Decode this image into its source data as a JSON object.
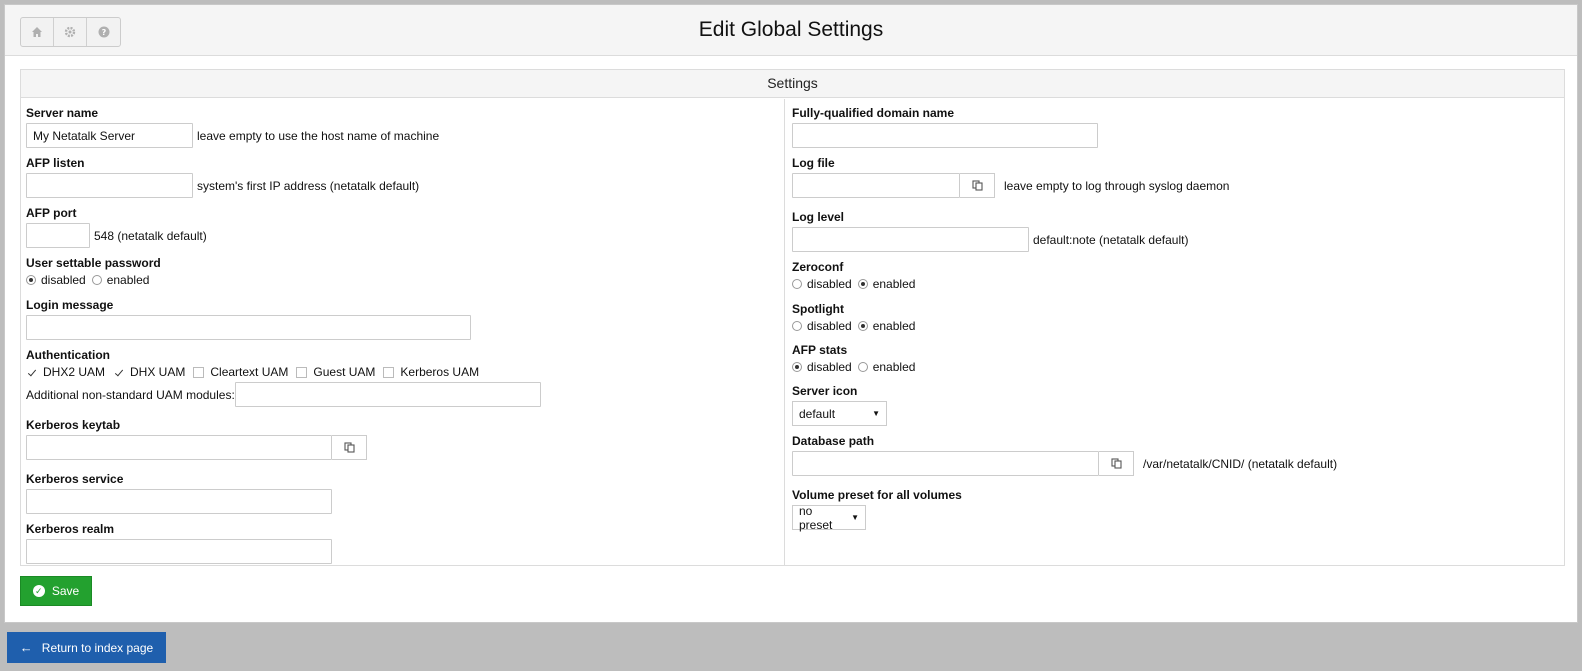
{
  "header": {
    "title": "Edit Global Settings",
    "buttons": [
      {
        "icon": "home-icon"
      },
      {
        "icon": "gear-icon"
      },
      {
        "icon": "help-icon"
      }
    ]
  },
  "settings": {
    "heading": "Settings",
    "left": {
      "server_name": {
        "label": "Server name",
        "value": "My Netatalk Server",
        "hint": "leave empty to use the host name of machine"
      },
      "afp_listen": {
        "label": "AFP listen",
        "value": "",
        "hint": "system's first IP address (netatalk default)"
      },
      "afp_port": {
        "label": "AFP port",
        "value": "",
        "hint": "548 (netatalk default)"
      },
      "user_password": {
        "label": "User settable password",
        "options": [
          "disabled",
          "enabled"
        ],
        "selected": "disabled"
      },
      "login_message": {
        "label": "Login message",
        "value": ""
      },
      "authentication": {
        "label": "Authentication",
        "options": [
          {
            "label": "DHX2 UAM",
            "checked": true
          },
          {
            "label": "DHX UAM",
            "checked": true
          },
          {
            "label": "Cleartext UAM",
            "checked": false
          },
          {
            "label": "Guest UAM",
            "checked": false
          },
          {
            "label": "Kerberos UAM",
            "checked": false
          }
        ],
        "additional_label": "Additional non-standard UAM modules:",
        "additional_value": ""
      },
      "kerberos_keytab": {
        "label": "Kerberos keytab",
        "value": ""
      },
      "kerberos_service": {
        "label": "Kerberos service",
        "value": ""
      },
      "kerberos_realm": {
        "label": "Kerberos realm",
        "value": ""
      }
    },
    "right": {
      "fqdn": {
        "label": "Fully-qualified domain name",
        "value": ""
      },
      "log_file": {
        "label": "Log file",
        "value": "",
        "hint": "leave empty to log through syslog daemon"
      },
      "log_level": {
        "label": "Log level",
        "value": "",
        "hint": "default:note (netatalk default)"
      },
      "zeroconf": {
        "label": "Zeroconf",
        "options": [
          "disabled",
          "enabled"
        ],
        "selected": "enabled"
      },
      "spotlight": {
        "label": "Spotlight",
        "options": [
          "disabled",
          "enabled"
        ],
        "selected": "enabled"
      },
      "afp_stats": {
        "label": "AFP stats",
        "options": [
          "disabled",
          "enabled"
        ],
        "selected": "disabled"
      },
      "server_icon": {
        "label": "Server icon",
        "selected": "default"
      },
      "database_path": {
        "label": "Database path",
        "value": "",
        "hint": "/var/netatalk/CNID/ (netatalk default)"
      },
      "volume_preset": {
        "label": "Volume preset for all volumes",
        "selected": "no preset"
      }
    }
  },
  "actions": {
    "save_label": "Save",
    "return_label": "Return to index page"
  },
  "colors": {
    "save": "#23a12f",
    "return": "#1f5fad"
  }
}
